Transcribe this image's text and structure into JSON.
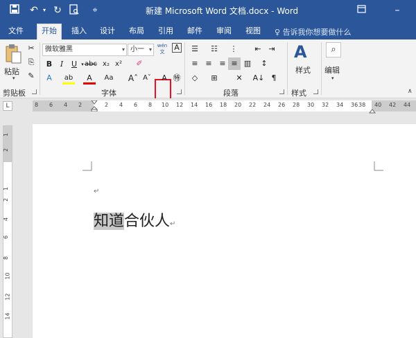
{
  "titlebar": {
    "title": "新建 Microsoft Word 文档.docx  -  Word",
    "icons": [
      "save-icon",
      "undo-icon",
      "redo-icon",
      "print-preview-icon",
      "customize-qat-icon",
      "ribbon-display-icon",
      "minimize-icon"
    ]
  },
  "tabs": [
    {
      "label": "文件"
    },
    {
      "label": "开始"
    },
    {
      "label": "插入"
    },
    {
      "label": "设计"
    },
    {
      "label": "布局"
    },
    {
      "label": "引用"
    },
    {
      "label": "邮件"
    },
    {
      "label": "审阅"
    },
    {
      "label": "视图"
    }
  ],
  "active_tab": "开始",
  "tell_me": "告诉我你想要做什么",
  "ribbon": {
    "clipboard": {
      "paste_label": "粘贴",
      "group_label": "剪贴板"
    },
    "font": {
      "font_name": "微软雅黑",
      "font_size": "小一",
      "group_label": "字体"
    },
    "paragraph": {
      "group_label": "段落"
    },
    "styles": {
      "styles_label": "样式",
      "group_label": "样式"
    },
    "editing": {
      "editing_label": "编辑"
    }
  },
  "ruler": {
    "h_numbers": [
      "8",
      "6",
      "4",
      "2",
      "2",
      "4",
      "6",
      "8",
      "10",
      "12",
      "14",
      "16",
      "18",
      "20",
      "22",
      "24",
      "26",
      "28",
      "30",
      "32",
      "34",
      "36",
      "38",
      "40",
      "42",
      "44"
    ],
    "v_numbers": [
      "1",
      "2",
      "1",
      "2",
      "4",
      "6",
      "8",
      "10",
      "12",
      "14"
    ],
    "corner": "L"
  },
  "document": {
    "empty_para_mark": "↵",
    "highlighted": "知道",
    "rest": "合伙人",
    "para_mark": "↵"
  }
}
